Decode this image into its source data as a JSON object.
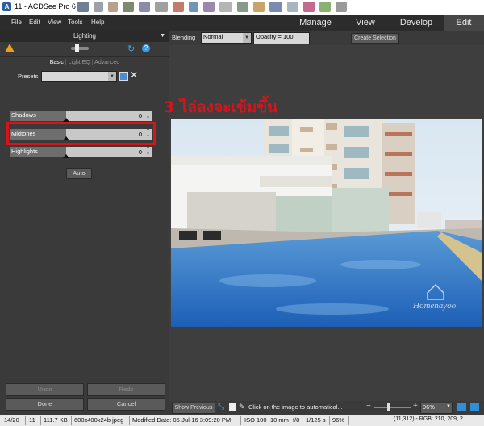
{
  "window": {
    "title": "11 - ACDSee Pro 6"
  },
  "menu": {
    "items": [
      "File",
      "Edit",
      "View",
      "Tools",
      "Help"
    ]
  },
  "modes": [
    {
      "label": "Manage",
      "active": false
    },
    {
      "label": "View",
      "active": false
    },
    {
      "label": "Develop",
      "active": false
    },
    {
      "label": "Edit",
      "active": true
    }
  ],
  "panel": {
    "title": "Lighting",
    "tabs": [
      "Basic",
      "Light EQ",
      "Advanced"
    ],
    "presets_label": "Presets",
    "presets_value": "",
    "sliders": [
      {
        "label": "Shadows",
        "value": "0"
      },
      {
        "label": "Midtones",
        "value": "0"
      },
      {
        "label": "Highlights",
        "value": "0"
      }
    ],
    "auto_label": "Auto",
    "undo_label": "Undo",
    "redo_label": "Redo",
    "done_label": "Done",
    "cancel_label": "Cancel"
  },
  "edit_toolbar": {
    "blending_label": "Blending",
    "blending_value": "Normal",
    "opacity_value": "Opacity = 100",
    "create_selection_label": "Create Selection"
  },
  "annotation": "3 ไล่ลงจะเข้มขึ้น",
  "watermark": "Homenayoo",
  "bottom_toolbar": {
    "show_previous_label": "Show Previous",
    "hint": "Click on the image to automatical...",
    "zoom": "96%"
  },
  "status": {
    "position": "14/20",
    "name": "11",
    "filesize": "111.7 KB",
    "dimensions": "600x400x24b jpeg",
    "modified": "Modified Date: 05-Jul-16 3:09:20 PM",
    "iso": "ISO 100",
    "focal": "10 mm",
    "aperture": "f/8",
    "shutter": "1/125 s",
    "zoom": "96%",
    "pixel": "(11,312) - RGB: 210, 209, 2"
  }
}
